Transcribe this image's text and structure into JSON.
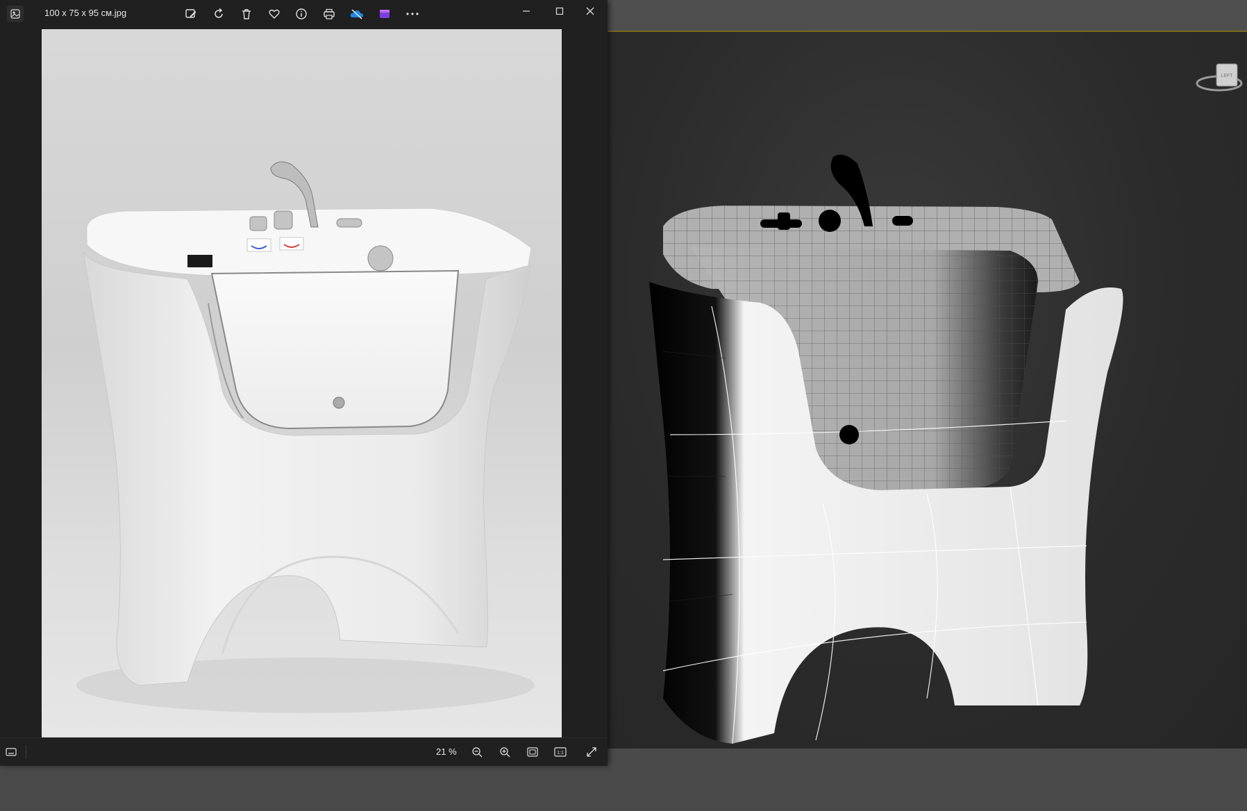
{
  "window": {
    "file_name": "100 x 75 x 95 см.jpg",
    "toolbar_icons": [
      "edit-image-icon",
      "rotate-icon",
      "delete-icon",
      "favorite-icon",
      "info-icon",
      "print-icon",
      "onedrive-icon",
      "clipchamp-icon",
      "more-icon"
    ],
    "window_controls": [
      "minimize-icon",
      "maximize-icon",
      "close-icon"
    ]
  },
  "status_bar": {
    "zoom": "21 %",
    "icons": [
      "filmstrip-icon",
      "zoom-out-icon",
      "zoom-in-icon",
      "fit-window-icon",
      "actual-size-icon",
      "full-screen-icon"
    ],
    "actual_size_label": "1:1"
  },
  "viewport": {
    "view_cube_label": "LEFT"
  },
  "colors": {
    "window_bg": "#202020",
    "viewport_bg": "#2b2b2b",
    "accent_line": "#7a6a1a"
  }
}
